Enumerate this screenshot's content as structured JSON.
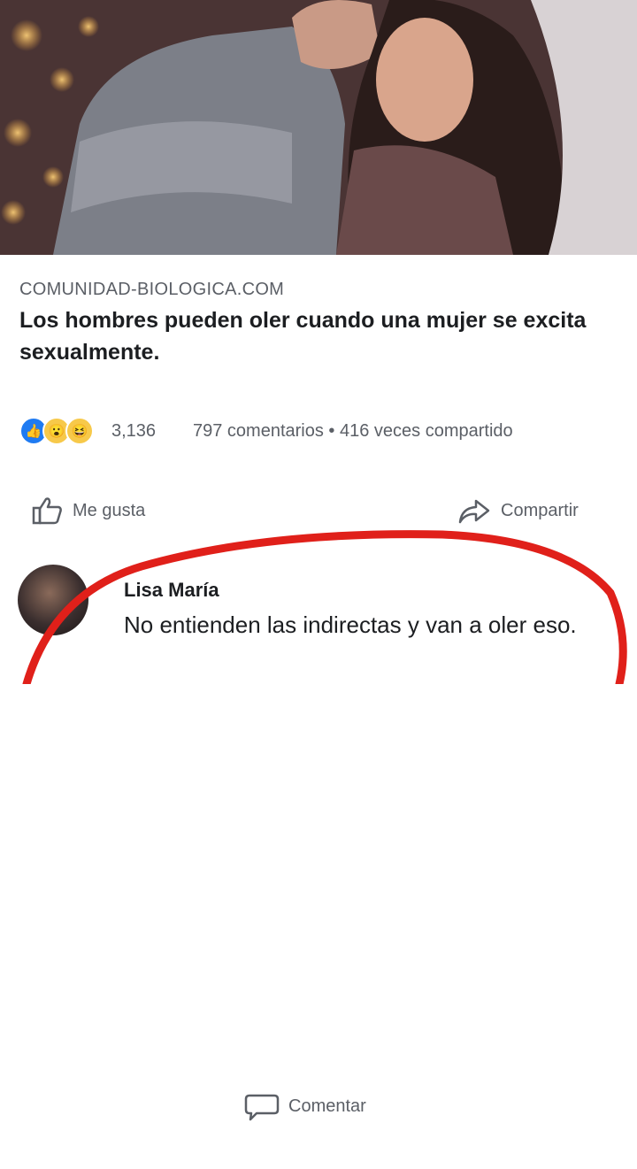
{
  "post": {
    "domain": "COMUNIDAD-BIOLOGICA.COM",
    "headline": "Los hombres pueden oler cuando una mujer se excita sexualmente."
  },
  "stats": {
    "reactions": [
      "like-icon",
      "wow-icon",
      "haha-icon"
    ],
    "reaction_count": "3,136",
    "comments_and_shares": "797 comentarios • 416 veces compartido"
  },
  "actions": {
    "like_label": "Me gusta",
    "comment_label": "Comentar",
    "share_label": "Compartir"
  },
  "comment": {
    "author": "Lisa María",
    "text": "No entienden las indirectas y van a oler eso."
  },
  "colors": {
    "facebook_blue": "#1f7bf2",
    "annotation_red": "#e0201a",
    "text_primary": "#1c1e21",
    "text_secondary": "#5b5f66"
  }
}
